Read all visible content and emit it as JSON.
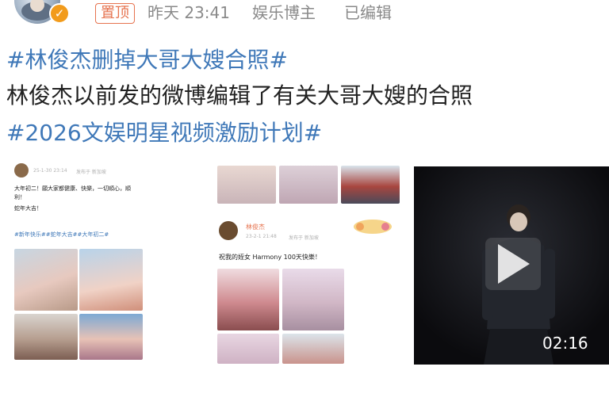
{
  "header": {
    "pinned_label": "置顶",
    "time": "昨天 23:41",
    "author_type": "娱乐博主",
    "edited": "已编辑"
  },
  "post": {
    "hashtag1": "#林俊杰删掉大哥大嫂合照#",
    "body": "林俊杰以前发的微博编辑了有关大哥大嫂的合照",
    "hashtag2": "#2026文娱明星视频激励计划#"
  },
  "left_card": {
    "date": "25-1-30 23:14",
    "source": "发布于 新加坡",
    "text1": "大年初二！願大家都健康、快樂，一切順心，順利！",
    "text2": "蛇年大吉！",
    "tags": "#新年快乐##蛇年大吉##大年初二#"
  },
  "mid_card": {
    "name": "林俊杰",
    "date": "23-2-1 21:48",
    "source": "发布于 新加坡",
    "text": "祝我的姪女 Harmony 100天快樂！"
  },
  "video": {
    "duration": "02:16"
  },
  "colors": {
    "hashtag": "#3f78b8",
    "pinned": "#e6734f",
    "verified_badge": "#f29b1b",
    "meta_gray": "#8a8a8a"
  },
  "icons": [
    "avatar",
    "verified-badge-icon",
    "play-icon"
  ]
}
